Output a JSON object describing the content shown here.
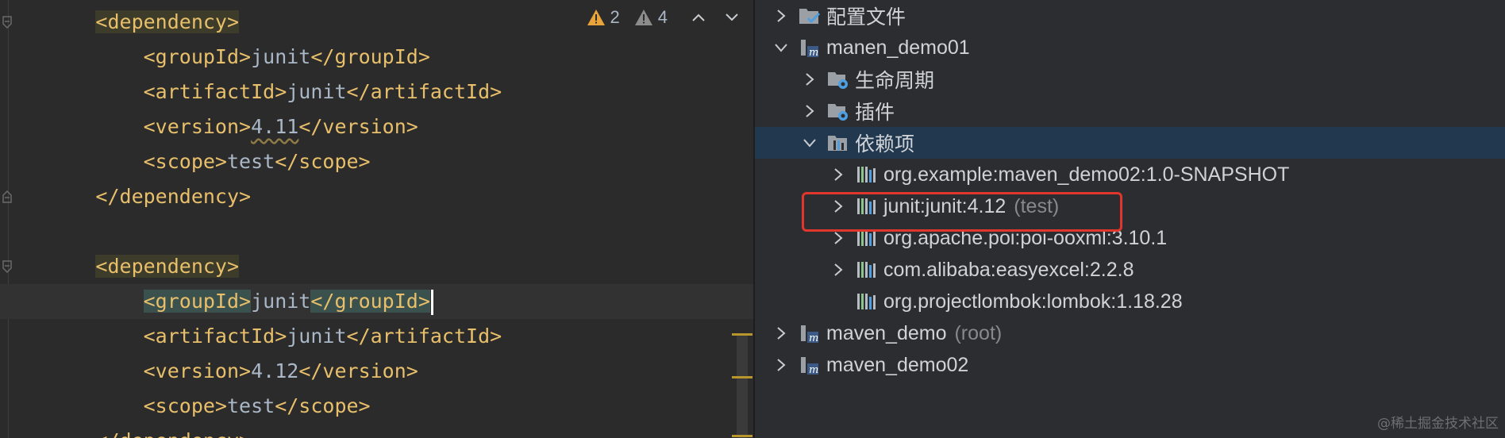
{
  "editor": {
    "lines": [
      {
        "indent": "        ",
        "parts": [
          {
            "t": "<dependency>",
            "c": "tag dep-hl"
          }
        ]
      },
      {
        "indent": "            ",
        "parts": [
          {
            "t": "<groupId>",
            "c": "tag"
          },
          {
            "t": "junit",
            "c": "txt"
          },
          {
            "t": "</groupId>",
            "c": "tag"
          }
        ]
      },
      {
        "indent": "            ",
        "parts": [
          {
            "t": "<artifactId>",
            "c": "tag"
          },
          {
            "t": "junit",
            "c": "txt"
          },
          {
            "t": "</artifactId>",
            "c": "tag"
          }
        ]
      },
      {
        "indent": "            ",
        "parts": [
          {
            "t": "<version>",
            "c": "tag"
          },
          {
            "t": "4.11",
            "c": "txt wavy"
          },
          {
            "t": "</version>",
            "c": "tag"
          }
        ]
      },
      {
        "indent": "            ",
        "parts": [
          {
            "t": "<scope>",
            "c": "tag"
          },
          {
            "t": "test",
            "c": "txt"
          },
          {
            "t": "</scope>",
            "c": "tag"
          }
        ]
      },
      {
        "indent": "        ",
        "parts": [
          {
            "t": "</dependency>",
            "c": "tag"
          }
        ]
      },
      {
        "indent": "",
        "parts": []
      },
      {
        "indent": "        ",
        "parts": [
          {
            "t": "<dependency>",
            "c": "tag dep-hl"
          }
        ]
      },
      {
        "indent": "            ",
        "current": true,
        "caret": true,
        "parts": [
          {
            "t": "<groupId>",
            "c": "tag hl-tag"
          },
          {
            "t": "junit",
            "c": "txt"
          },
          {
            "t": "</groupId>",
            "c": "tag hl-tag"
          }
        ]
      },
      {
        "indent": "            ",
        "parts": [
          {
            "t": "<artifactId>",
            "c": "tag"
          },
          {
            "t": "junit",
            "c": "txt"
          },
          {
            "t": "</artifactId>",
            "c": "tag"
          }
        ]
      },
      {
        "indent": "            ",
        "parts": [
          {
            "t": "<version>",
            "c": "tag"
          },
          {
            "t": "4.12",
            "c": "txt"
          },
          {
            "t": "</version>",
            "c": "tag"
          }
        ]
      },
      {
        "indent": "            ",
        "parts": [
          {
            "t": "<scope>",
            "c": "tag"
          },
          {
            "t": "test",
            "c": "txt"
          },
          {
            "t": "</scope>",
            "c": "tag"
          }
        ]
      },
      {
        "indent": "        ",
        "parts": [
          {
            "t": "</dependency>",
            "c": "tag"
          }
        ]
      }
    ],
    "inspections": {
      "errors": "2",
      "warnings": "4"
    }
  },
  "tree": {
    "rows": [
      {
        "label": "配置文件",
        "suffix": "",
        "level": 0,
        "chevron": "right",
        "icon": "config-folder-icon"
      },
      {
        "label": "manen_demo01",
        "suffix": "",
        "level": 0,
        "chevron": "down",
        "icon": "maven-module-icon"
      },
      {
        "label": "生命周期",
        "suffix": "",
        "level": 1,
        "chevron": "right",
        "icon": "lifecycle-folder-icon"
      },
      {
        "label": "插件",
        "suffix": "",
        "level": 1,
        "chevron": "right",
        "icon": "plugins-folder-icon"
      },
      {
        "label": "依赖项",
        "suffix": "",
        "level": 1,
        "chevron": "down",
        "icon": "dependencies-icon",
        "selected": true
      },
      {
        "label": "org.example:maven_demo02:1.0-SNAPSHOT",
        "suffix": "",
        "level": 2,
        "chevron": "right",
        "icon": "library-icon"
      },
      {
        "label": "junit:junit:4.12",
        "suffix": "(test)",
        "level": 2,
        "chevron": "right",
        "icon": "library-icon"
      },
      {
        "label": "org.apache.poi:poi-ooxml:3.10.1",
        "suffix": "",
        "level": 2,
        "chevron": "right",
        "icon": "library-icon"
      },
      {
        "label": "com.alibaba:easyexcel:2.2.8",
        "suffix": "",
        "level": 2,
        "chevron": "right",
        "icon": "library-icon"
      },
      {
        "label": "org.projectlombok:lombok:1.18.28",
        "suffix": "",
        "level": 2,
        "chevron": "none",
        "icon": "library-icon"
      },
      {
        "label": "maven_demo",
        "suffix": "(root)",
        "level": 0,
        "chevron": "right",
        "icon": "maven-module-icon"
      },
      {
        "label": "maven_demo02",
        "suffix": "",
        "level": 0,
        "chevron": "right",
        "icon": "maven-module-icon"
      }
    ]
  },
  "watermark": "@稀土掘金技术社区",
  "colors": {
    "tag": "#e8bf6a",
    "text": "#a9b7c6",
    "highlight_box": "#e0362b",
    "selection": "#22384f"
  }
}
